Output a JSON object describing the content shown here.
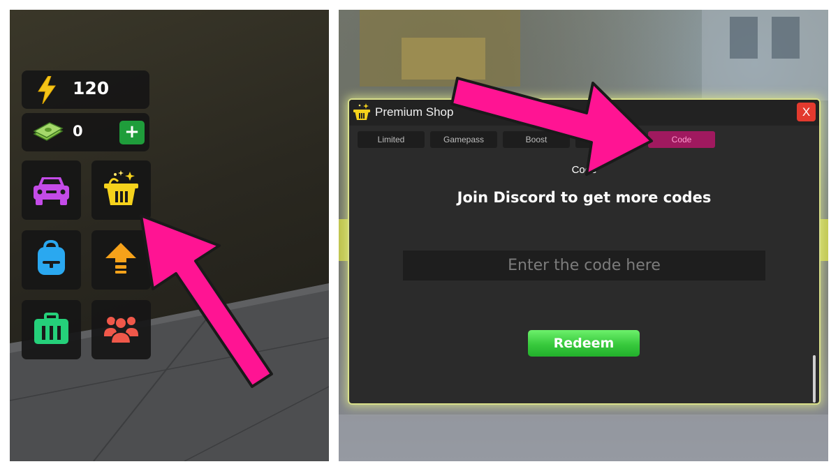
{
  "hud": {
    "energy": {
      "icon": "lightning-icon",
      "value": "120"
    },
    "cash": {
      "icon": "cash-stack-icon",
      "value": "0",
      "add_label": "+"
    },
    "menu_buttons": [
      {
        "name": "car-icon",
        "color": "#c44be8"
      },
      {
        "name": "shop-basket-icon",
        "color": "#f5d21c"
      },
      {
        "name": "backpack-icon",
        "color": "#2aa8f0"
      },
      {
        "name": "upgrade-arrow-icon",
        "color": "#f6a21a"
      },
      {
        "name": "toolbox-icon",
        "color": "#25d07a"
      },
      {
        "name": "friends-icon",
        "color": "#f0584a"
      }
    ]
  },
  "shop": {
    "title": "Premium Shop",
    "close_label": "X",
    "tabs": [
      {
        "label": "Limited"
      },
      {
        "label": "Gamepass"
      },
      {
        "label": "Boost"
      },
      {
        "label": ""
      },
      {
        "label": "Code"
      }
    ],
    "active_tab": "Code",
    "section_label": "Code",
    "promo_text": "Join Discord to get more codes",
    "code_input": {
      "value": "",
      "placeholder": "Enter the code here"
    },
    "redeem_label": "Redeem"
  },
  "colors": {
    "arrow": "#ff1493",
    "accent_tab": "#a0195f",
    "redeem_green": "#38c93d",
    "close_red": "#e33a2e",
    "window_glow": "#d9e08a"
  }
}
